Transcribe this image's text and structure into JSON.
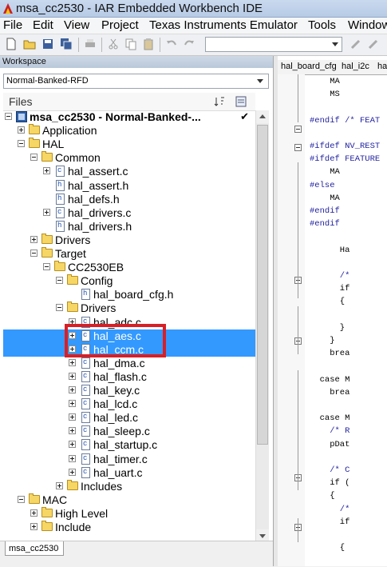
{
  "window": {
    "title": "msa_cc2530 - IAR Embedded Workbench IDE"
  },
  "menu": [
    "File",
    "Edit",
    "View",
    "Project",
    "Texas Instruments Emulator",
    "Tools",
    "Window"
  ],
  "toolbar": {
    "combo_value": ""
  },
  "workspace": {
    "header": "Workspace",
    "configuration": "Normal-Banked-RFD",
    "files_header": "Files",
    "tab": "msa_cc2530"
  },
  "tree": [
    {
      "label": "msa_cc2530 - Normal-Banked-...",
      "type": "project",
      "check": "✔"
    },
    {
      "label": "Application",
      "type": "folder"
    },
    {
      "label": "HAL",
      "type": "folder"
    },
    {
      "label": "Common",
      "type": "folder"
    },
    {
      "label": "hal_assert.c",
      "type": "file"
    },
    {
      "label": "hal_assert.h",
      "type": "file"
    },
    {
      "label": "hal_defs.h",
      "type": "file"
    },
    {
      "label": "hal_drivers.c",
      "type": "file"
    },
    {
      "label": "hal_drivers.h",
      "type": "file"
    },
    {
      "label": "Drivers",
      "type": "folder"
    },
    {
      "label": "Target",
      "type": "folder"
    },
    {
      "label": "CC2530EB",
      "type": "folder"
    },
    {
      "label": "Config",
      "type": "folder"
    },
    {
      "label": "hal_board_cfg.h",
      "type": "file"
    },
    {
      "label": "Drivers",
      "type": "folder"
    },
    {
      "label": "hal_adc.c",
      "type": "file"
    },
    {
      "label": "hal_aes.c",
      "type": "file"
    },
    {
      "label": "hal_ccm.c",
      "type": "file"
    },
    {
      "label": "hal_dma.c",
      "type": "file"
    },
    {
      "label": "hal_flash.c",
      "type": "file"
    },
    {
      "label": "hal_key.c",
      "type": "file"
    },
    {
      "label": "hal_lcd.c",
      "type": "file"
    },
    {
      "label": "hal_led.c",
      "type": "file"
    },
    {
      "label": "hal_sleep.c",
      "type": "file"
    },
    {
      "label": "hal_startup.c",
      "type": "file"
    },
    {
      "label": "hal_timer.c",
      "type": "file"
    },
    {
      "label": "hal_uart.c",
      "type": "file"
    },
    {
      "label": "Includes",
      "type": "folder"
    },
    {
      "label": "MAC",
      "type": "folder"
    },
    {
      "label": "High Level",
      "type": "folder"
    },
    {
      "label": "Include",
      "type": "folder"
    }
  ],
  "editor": {
    "tabs": [
      "hal_board_cfg",
      "hal_i2c",
      "hal_"
    ],
    "lines": [
      "    MA",
      "    MS",
      "",
      "#endif /* FEAT",
      "",
      "#ifdef NV_REST",
      "#ifdef FEATURE",
      "    MA",
      "#else",
      "    MA",
      "#endif",
      "#endif",
      "",
      "      Ha",
      "",
      "      /*",
      "      if",
      "      {",
      "",
      "      }",
      "    }",
      "    brea",
      "",
      "  case M",
      "    brea",
      "",
      "  case M",
      "    /* R",
      "    pDat",
      "",
      "    /* C",
      "    if (",
      "    {",
      "      /*",
      "      if",
      "",
      "      {"
    ]
  }
}
